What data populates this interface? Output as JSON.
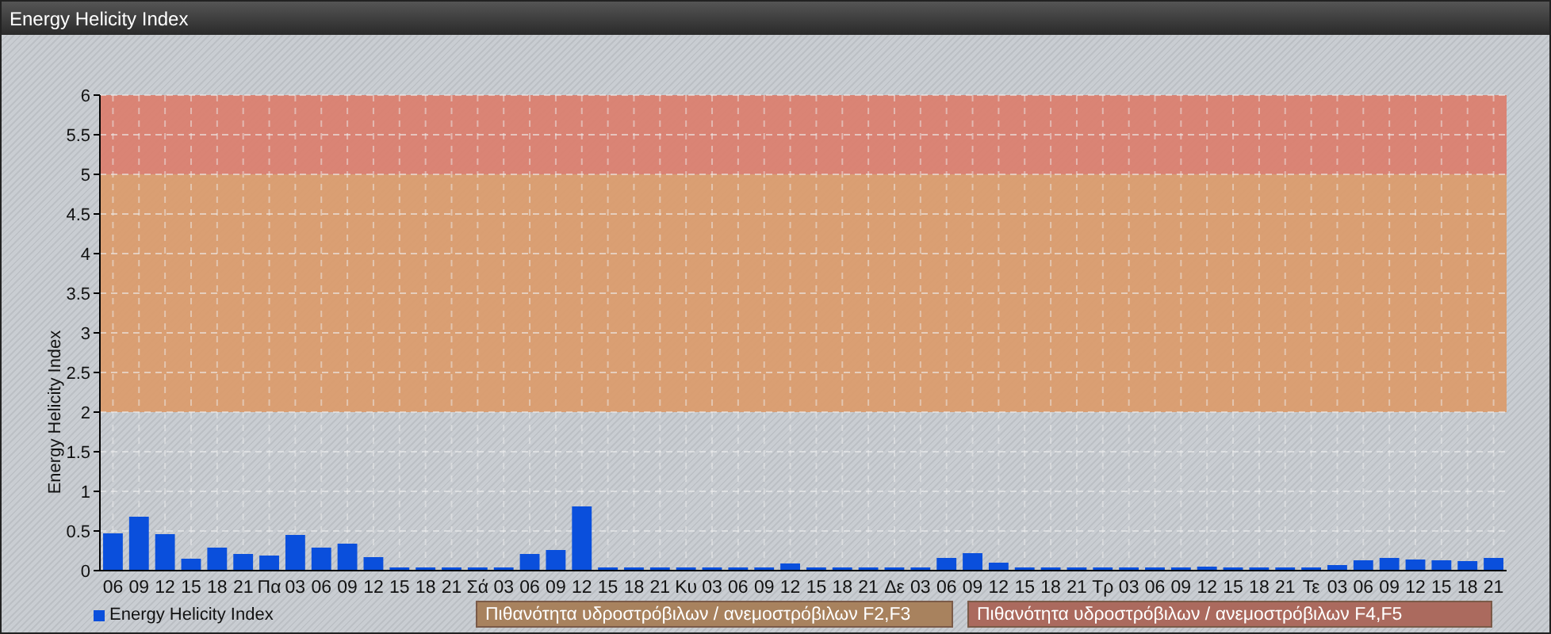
{
  "window": {
    "title": "Energy Helicity Index"
  },
  "chart": {
    "chart_data": {
      "type": "bar",
      "ylabel": "Energy Helicity Index",
      "ylim": [
        0,
        6
      ],
      "yticks": [
        0,
        0.5,
        1,
        1.5,
        2,
        2.5,
        3,
        3.5,
        4,
        4.5,
        5,
        5.5,
        6
      ],
      "grid": true,
      "categories": [
        "06",
        "09",
        "12",
        "15",
        "18",
        "21",
        "Πα",
        "03",
        "06",
        "09",
        "12",
        "15",
        "18",
        "21",
        "Σά",
        "03",
        "06",
        "09",
        "12",
        "15",
        "18",
        "21",
        "Κυ",
        "03",
        "06",
        "09",
        "12",
        "15",
        "18",
        "21",
        "Δε",
        "03",
        "06",
        "09",
        "12",
        "15",
        "18",
        "21",
        "Τρ",
        "03",
        "06",
        "09",
        "12",
        "15",
        "18",
        "21",
        "Τε",
        "03",
        "06",
        "09",
        "12",
        "15",
        "18",
        "21"
      ],
      "series": [
        {
          "name": "Energy Helicity Index",
          "color": "#0a4fdc",
          "values": [
            0.47,
            0.68,
            0.46,
            0.15,
            0.29,
            0.21,
            0.19,
            0.45,
            0.29,
            0.34,
            0.17,
            0.01,
            0.01,
            0.01,
            0.01,
            0.01,
            0.21,
            0.26,
            0.81,
            0.01,
            0.01,
            0.01,
            0.01,
            0.03,
            0.03,
            0.03,
            0.09,
            0.02,
            0.01,
            0.01,
            0.01,
            0.04,
            0.16,
            0.22,
            0.1,
            0.01,
            0.01,
            0.01,
            0.01,
            0.01,
            0.01,
            0.03,
            0.05,
            0.01,
            0.01,
            0.04,
            0.03,
            0.07,
            0.13,
            0.16,
            0.14,
            0.13,
            0.12,
            0.16
          ]
        }
      ],
      "bands": [
        {
          "axis": "y",
          "from": 2,
          "to": 5,
          "color": "#dc9a68"
        },
        {
          "axis": "y",
          "from": 5,
          "to": 6,
          "color": "#dc7c6a"
        }
      ]
    }
  },
  "legend": {
    "bands": [
      {
        "label": "Πιθανότητα υδροστρόβιλων / ανεμοστρόβιλων F2,F3",
        "color": "#a8825e"
      },
      {
        "label": "Πιθανότητα υδροστρόβιλων / ανεμοστρόβιλων F4,F5",
        "color": "#ab6a5e"
      }
    ]
  }
}
